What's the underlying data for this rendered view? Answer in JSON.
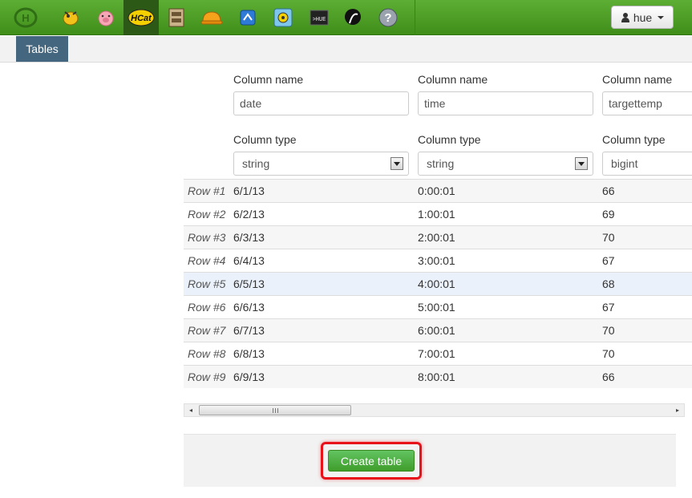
{
  "nav": {
    "icons": [
      {
        "name": "hue-logo-icon"
      },
      {
        "name": "beeswax-hive-icon"
      },
      {
        "name": "pig-icon"
      },
      {
        "name": "hcatalog-icon",
        "label": "HCat"
      },
      {
        "name": "file-browser-icon"
      },
      {
        "name": "job-designer-icon"
      },
      {
        "name": "oozie-icon"
      },
      {
        "name": "job-browser-icon"
      },
      {
        "name": "shell-icon",
        "label": ">HUE"
      },
      {
        "name": "user-admin-icon"
      },
      {
        "name": "help-icon",
        "label": "?"
      }
    ],
    "user_label": "hue",
    "accent_color": "#4a9e22"
  },
  "subnav": {
    "tab_label": "Tables"
  },
  "columns": [
    {
      "name_label": "Column name",
      "name_value": "date",
      "type_label": "Column type",
      "type_value": "string"
    },
    {
      "name_label": "Column name",
      "name_value": "time",
      "type_label": "Column type",
      "type_value": "string"
    },
    {
      "name_label": "Column name",
      "name_value": "targettemp",
      "type_label": "Column type",
      "type_value": "bigint"
    }
  ],
  "rows": [
    {
      "label": "Row #1",
      "values": [
        "6/1/13",
        "0:00:01",
        "66"
      ]
    },
    {
      "label": "Row #2",
      "values": [
        "6/2/13",
        "1:00:01",
        "69"
      ]
    },
    {
      "label": "Row #3",
      "values": [
        "6/3/13",
        "2:00:01",
        "70"
      ]
    },
    {
      "label": "Row #4",
      "values": [
        "6/4/13",
        "3:00:01",
        "67"
      ]
    },
    {
      "label": "Row #5",
      "values": [
        "6/5/13",
        "4:00:01",
        "68"
      ]
    },
    {
      "label": "Row #6",
      "values": [
        "6/6/13",
        "5:00:01",
        "67"
      ]
    },
    {
      "label": "Row #7",
      "values": [
        "6/7/13",
        "6:00:01",
        "70"
      ]
    },
    {
      "label": "Row #8",
      "values": [
        "6/8/13",
        "7:00:01",
        "70"
      ]
    },
    {
      "label": "Row #9",
      "values": [
        "6/9/13",
        "8:00:01",
        "66"
      ]
    }
  ],
  "scrollbar": {
    "left_arrow": "◂",
    "right_arrow": "▸"
  },
  "actions": {
    "create_label": "Create table",
    "button_color": "#4caf36",
    "highlight_color": "#e8121b"
  }
}
